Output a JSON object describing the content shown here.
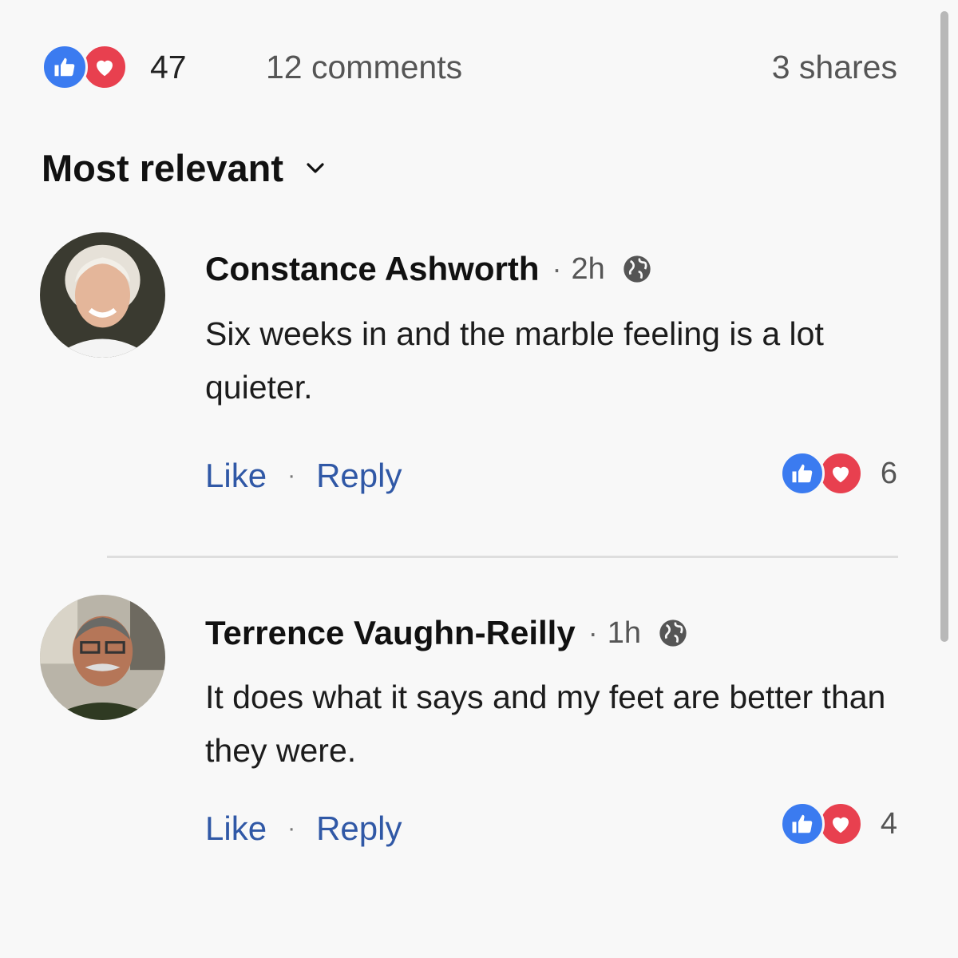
{
  "summary": {
    "reaction_count": "47",
    "comments": "12 comments",
    "shares": "3 shares",
    "reaction_icons": [
      "like-icon",
      "love-icon"
    ]
  },
  "sort": {
    "label": "Most relevant",
    "icon": "chevron-down-icon"
  },
  "comments": [
    {
      "author": "Constance Ashworth",
      "separator": "·",
      "time": "2h",
      "privacy_icon": "globe-icon",
      "text": "Six weeks in and the marble feeling is a lot quieter.",
      "like_label": "Like",
      "action_separator": "·",
      "reply_label": "Reply",
      "reaction_count": "6"
    },
    {
      "author": "Terrence Vaughn-Reilly",
      "separator": "·",
      "time": "1h",
      "privacy_icon": "globe-icon",
      "text": "It does what it says and my feet are better than they were.",
      "like_label": "Like",
      "action_separator": "·",
      "reply_label": "Reply",
      "reaction_count": "4"
    }
  ],
  "colors": {
    "like": "#3b7bf0",
    "love": "#e8404f",
    "action_link": "#3058a6",
    "background": "#f8f8f8"
  }
}
